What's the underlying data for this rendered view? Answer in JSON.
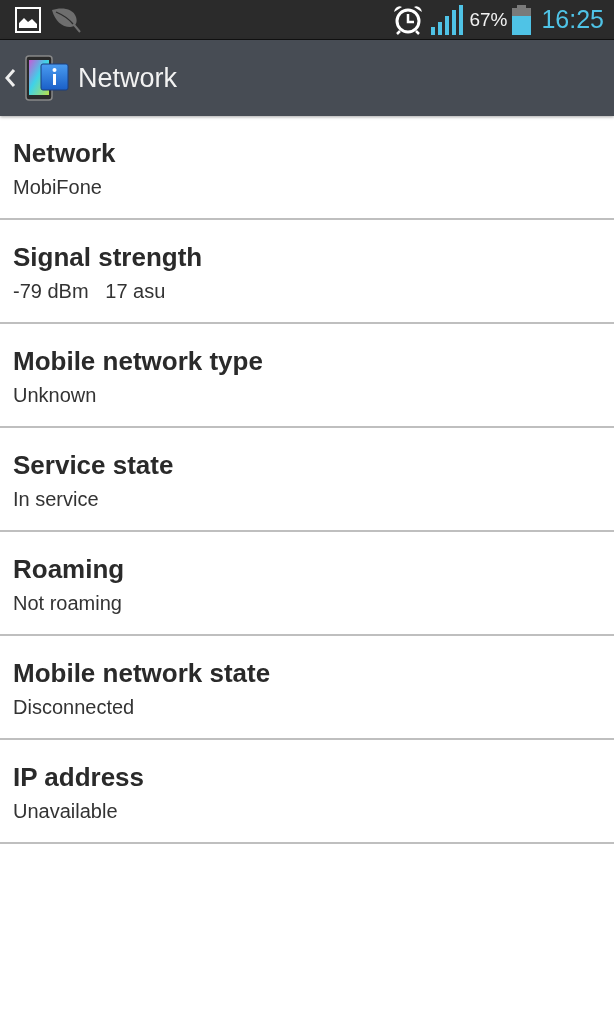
{
  "status_bar": {
    "battery_text": "67%",
    "time": "16:25"
  },
  "action_bar": {
    "title": "Network"
  },
  "items": [
    {
      "title": "Network",
      "summary": "MobiFone"
    },
    {
      "title": "Signal strength",
      "summary": "-79 dBm   17 asu"
    },
    {
      "title": "Mobile network type",
      "summary": "Unknown"
    },
    {
      "title": "Service state",
      "summary": "In service"
    },
    {
      "title": "Roaming",
      "summary": "Not roaming"
    },
    {
      "title": "Mobile network state",
      "summary": "Disconnected"
    },
    {
      "title": "IP address",
      "summary": "Unavailable"
    }
  ]
}
